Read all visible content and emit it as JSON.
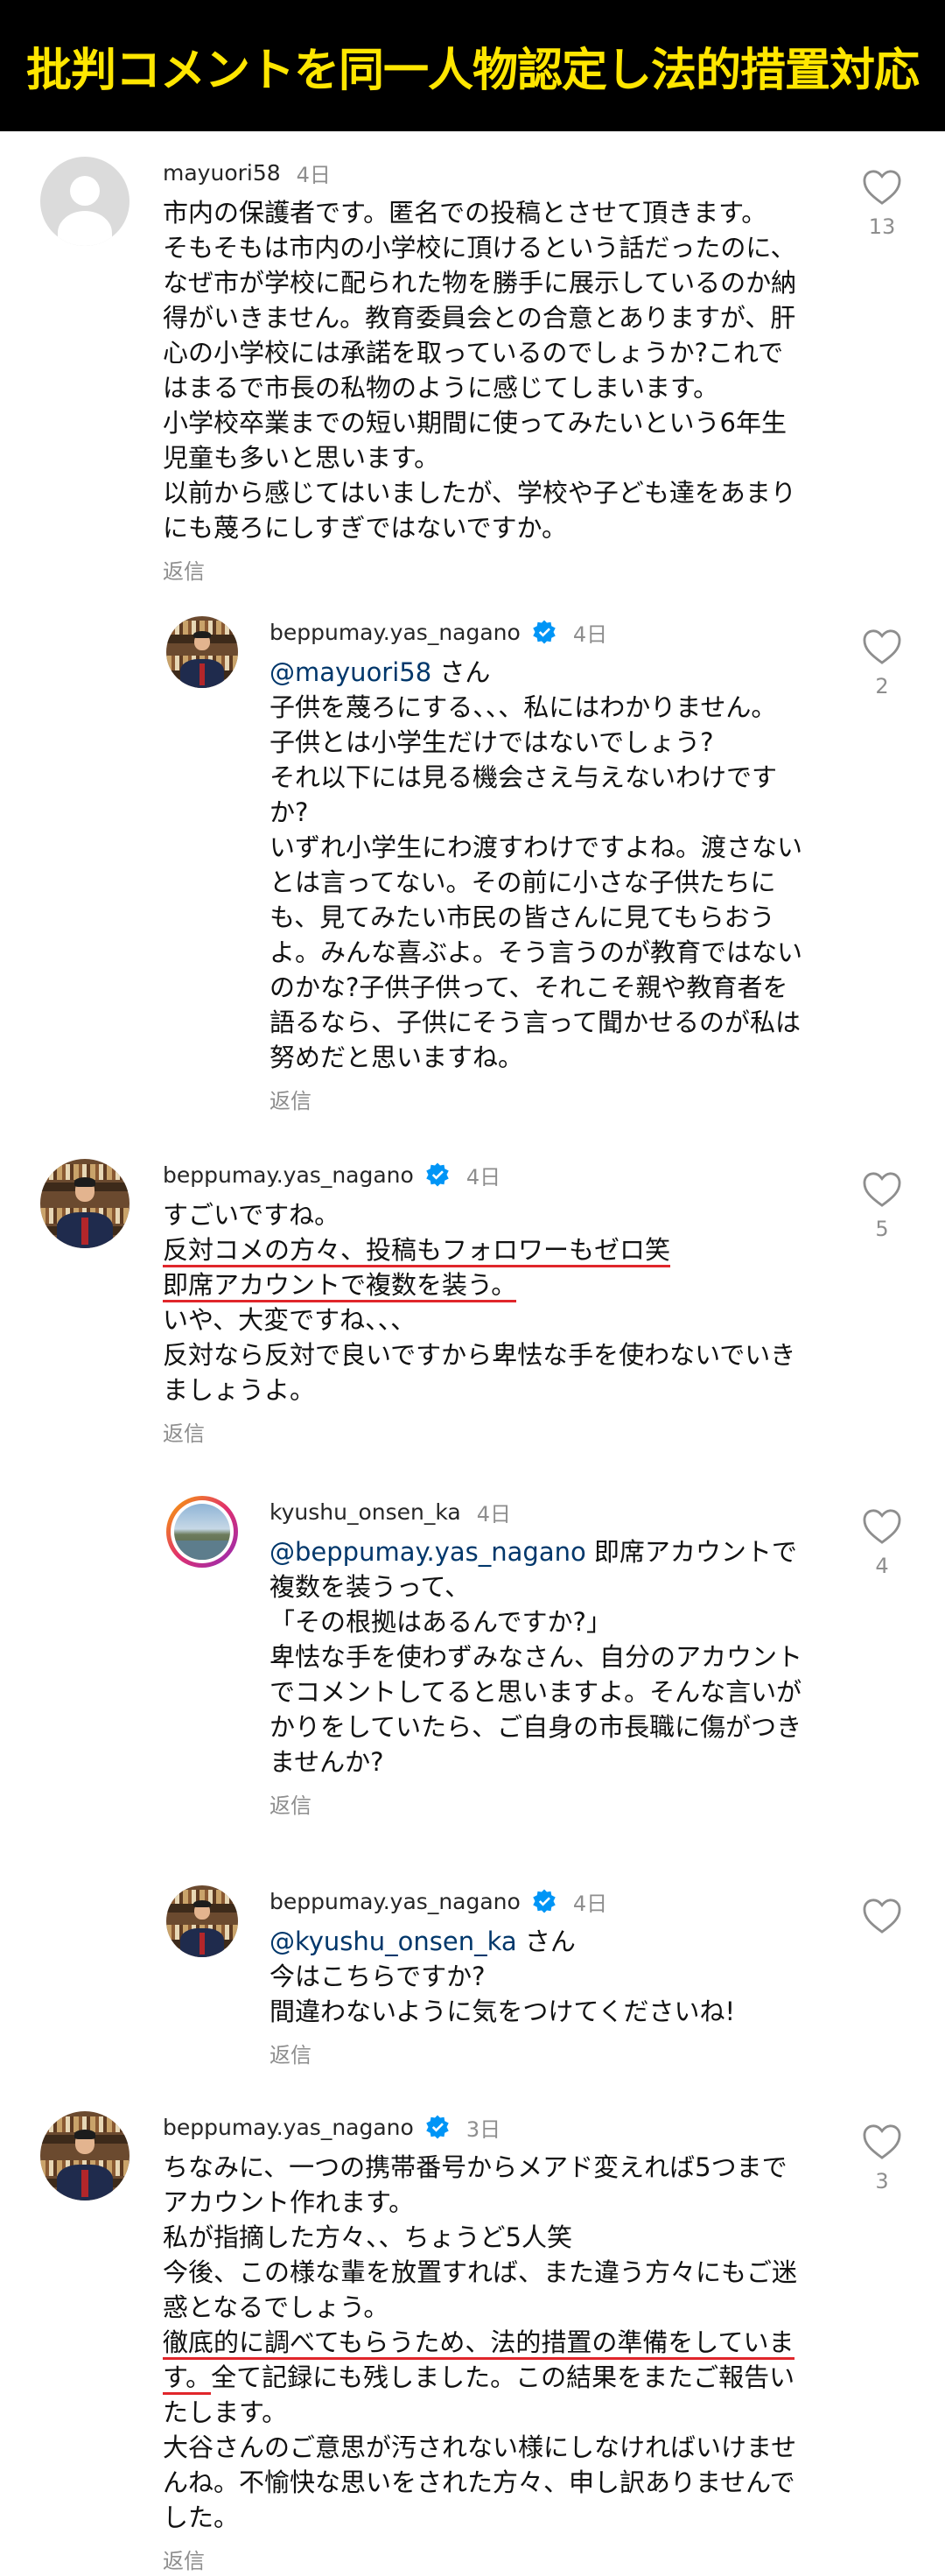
{
  "banner": {
    "title": "批判コメントを同一人物認定し法的措置対応",
    "bg": "#000000",
    "color": "#ffe600"
  },
  "labels": {
    "reply": "返信"
  },
  "colors": {
    "underline": "#e0262b",
    "mention": "#00376b",
    "verified": "#0095f6"
  },
  "comments": [
    {
      "username": "mayuori58",
      "time": "4日",
      "likes": "13",
      "lines": [
        "市内の保護者です。匿名での投稿とさせて頂きます。",
        "そもそもは市内の小学校に頂けるという話だったのに、",
        "なぜ市が学校に配られた物を勝手に展示しているのか納",
        "得がいきません。教育委員会との合意とありますが、肝",
        "心の小学校には承諾を取っているのでしょうか?これで",
        "はまるで市長の私物のように感じてしまいます。",
        "小学校卒業までの短い期間に使ってみたいという6年生",
        "児童も多いと思います。",
        "以前から感じてはいましたが、学校や子ども達をあまり",
        "にも蔑ろにしすぎではないですか。"
      ]
    },
    {
      "username": "beppumay.yas_nagano",
      "time": "4日",
      "likes": "2",
      "mention": "@mayuori58",
      "mention_suffix": " さん",
      "lines": [
        "子供を蔑ろにする、、、私にはわかりません。",
        "子供とは小学生だけではないでしょう?",
        "それ以下には見る機会さえ与えないわけです",
        "か?",
        "いずれ小学生にわ渡すわけですよね。渡さない",
        "とは言ってない。その前に小さな子供たちに",
        "も、見てみたい市民の皆さんに見てもらおう",
        "よ。みんな喜ぶよ。そう言うのが教育ではない",
        "のかな?子供子供って、それこそ親や教育者を",
        "語るなら、子供にそう言って聞かせるのが私は",
        "努めだと思いますね。"
      ]
    },
    {
      "username": "beppumay.yas_nagano",
      "time": "4日",
      "likes": "5",
      "lines": [
        "すごいですね。",
        "反対コメの方々、投稿もフォロワーもゼロ笑",
        "即席アカウントで複数を装う。",
        "いや、大変ですね、、、",
        "反対なら反対で良いですから卑怯な手を使わないでいき",
        "ましょうよ。"
      ]
    },
    {
      "username": "kyushu_onsen_ka",
      "time": "4日",
      "likes": "4",
      "mention": "@beppumay.yas_nagano",
      "mention_suffix": " 即席アカウントで",
      "lines": [
        "複数を装うって、",
        "「その根拠はあるんですか?」",
        "卑怯な手を使わずみなさん、自分のアカウント",
        "でコメントしてると思いますよ。そんな言いが",
        "かりをしていたら、ご自身の市長職に傷がつき",
        "ませんか?"
      ]
    },
    {
      "username": "beppumay.yas_nagano",
      "time": "4日",
      "likes": "",
      "mention": "@kyushu_onsen_ka",
      "mention_suffix": " さん",
      "lines": [
        "今はこちらですか?",
        "間違わないように気をつけてくださいね!"
      ]
    },
    {
      "username": "beppumay.yas_nagano",
      "time": "3日",
      "likes": "3",
      "lines": [
        "ちなみに、一つの携帯番号からメアド変えれば5つまで",
        "アカウント作れます。",
        "私が指摘した方々、、ちょうど5人笑",
        "今後、この様な輩を放置すれば、また違う方々にもご迷",
        "惑となるでしょう。",
        "徹底的に調べてもらうため、法的措置の準備をしていま",
        "す。",
        "全て記録にも残しました。この結果をまたご報告い",
        "たします。",
        "大谷さんのご意思が汚されない様にしなければいけませ",
        "んね。不愉快な思いをされた方々、申し訳ありませんで",
        "した。"
      ]
    }
  ]
}
